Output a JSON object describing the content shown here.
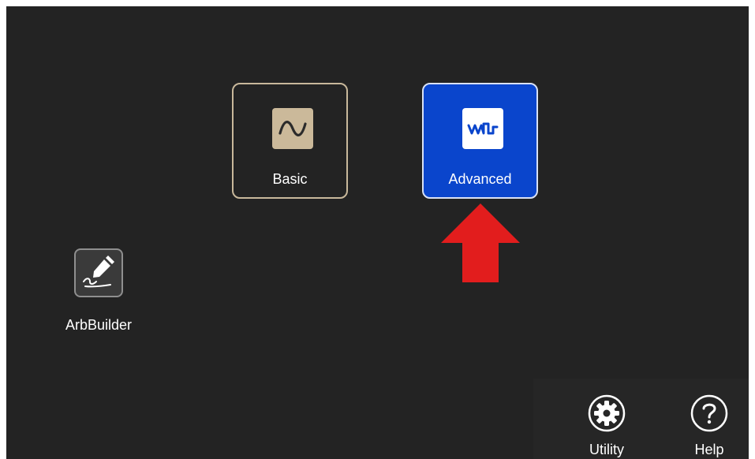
{
  "screen": {
    "background_color": "#232323"
  },
  "mode_tiles": [
    {
      "label": "Basic",
      "icon": "sine-wave-icon",
      "selected": false
    },
    {
      "label": "Advanced",
      "icon": "complex-waveform-icon",
      "selected": true,
      "accent_color": "#0a45cc"
    }
  ],
  "apps": [
    {
      "label": "ArbBuilder",
      "icon": "pen-signature-icon"
    }
  ],
  "bottom_bar": {
    "utility_label": "Utility",
    "utility_icon": "gear-icon",
    "help_label": "Help",
    "help_icon": "question-mark-icon"
  },
  "annotation": {
    "arrow_color": "#e21d1d",
    "arrow_direction": "up"
  }
}
